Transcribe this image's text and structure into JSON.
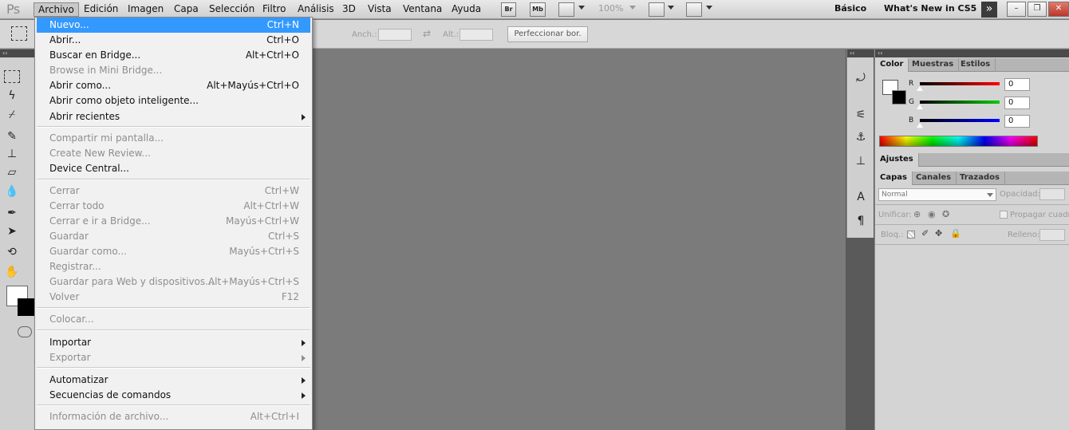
{
  "app": {
    "logo": "Ps"
  },
  "menubar": {
    "items": [
      "Archivo",
      "Edición",
      "Imagen",
      "Capa",
      "Selección",
      "Filtro",
      "Análisis",
      "3D",
      "Vista",
      "Ventana",
      "Ayuda"
    ],
    "active": "Archivo",
    "bridge_icon": "Br",
    "minibridge_icon": "Mb",
    "zoom": "100%",
    "workspaces": [
      "Básico",
      "What's New in CS5"
    ]
  },
  "options": {
    "width_label": "Anch.:",
    "height_label": "Alt.:",
    "refine_button": "Perfeccionar bor."
  },
  "panels": {
    "color_tabs": [
      "Color",
      "Muestras",
      "Estilos"
    ],
    "channels": [
      {
        "label": "R",
        "value": "0",
        "color": "#ff0000"
      },
      {
        "label": "G",
        "value": "0",
        "color": "#00cc00"
      },
      {
        "label": "B",
        "value": "0",
        "color": "#0000ff"
      }
    ],
    "adjustments_tab": "Ajustes",
    "layer_tabs": [
      "Capas",
      "Canales",
      "Trazados"
    ],
    "blend_mode": "Normal",
    "opacity_label": "Opacidad:",
    "unify_label": "Unificar:",
    "propagate_label": "Propagar cuadro",
    "lock_label": "Bloq.:",
    "fill_label": "Relleno:"
  },
  "file_menu": {
    "items": [
      {
        "label": "Nuevo...",
        "shortcut": "Ctrl+N",
        "disabled": false,
        "highlight": true
      },
      {
        "label": "Abrir...",
        "shortcut": "Ctrl+O",
        "disabled": false
      },
      {
        "label": "Buscar en Bridge...",
        "shortcut": "Alt+Ctrl+O",
        "disabled": false
      },
      {
        "label": "Browse in Mini Bridge...",
        "shortcut": "",
        "disabled": true
      },
      {
        "label": "Abrir como...",
        "shortcut": "Alt+Mayús+Ctrl+O",
        "disabled": false
      },
      {
        "label": "Abrir como objeto inteligente...",
        "shortcut": "",
        "disabled": false
      },
      {
        "label": "Abrir recientes",
        "shortcut": "",
        "disabled": false,
        "submenu": true
      },
      {
        "label": "Compartir mi pantalla...",
        "shortcut": "",
        "disabled": true
      },
      {
        "label": "Create New Review...",
        "shortcut": "",
        "disabled": true
      },
      {
        "label": "Device Central...",
        "shortcut": "",
        "disabled": false
      },
      {
        "label": "Cerrar",
        "shortcut": "Ctrl+W",
        "disabled": true
      },
      {
        "label": "Cerrar todo",
        "shortcut": "Alt+Ctrl+W",
        "disabled": true
      },
      {
        "label": "Cerrar e ir a Bridge...",
        "shortcut": "Mayús+Ctrl+W",
        "disabled": true
      },
      {
        "label": "Guardar",
        "shortcut": "Ctrl+S",
        "disabled": true
      },
      {
        "label": "Guardar como...",
        "shortcut": "Mayús+Ctrl+S",
        "disabled": true
      },
      {
        "label": "Registrar...",
        "shortcut": "",
        "disabled": true
      },
      {
        "label": "Guardar para Web y dispositivos...",
        "shortcut": "Alt+Mayús+Ctrl+S",
        "disabled": true
      },
      {
        "label": "Volver",
        "shortcut": "F12",
        "disabled": true
      },
      {
        "label": "Colocar...",
        "shortcut": "",
        "disabled": true
      },
      {
        "label": "Importar",
        "shortcut": "",
        "disabled": false,
        "submenu": true
      },
      {
        "label": "Exportar",
        "shortcut": "",
        "disabled": true,
        "submenu": true
      },
      {
        "label": "Automatizar",
        "shortcut": "",
        "disabled": false,
        "submenu": true
      },
      {
        "label": "Secuencias de comandos",
        "shortcut": "",
        "disabled": false,
        "submenu": true
      },
      {
        "label": "Información de archivo...",
        "shortcut": "Alt+Ctrl+I",
        "disabled": true
      }
    ]
  }
}
